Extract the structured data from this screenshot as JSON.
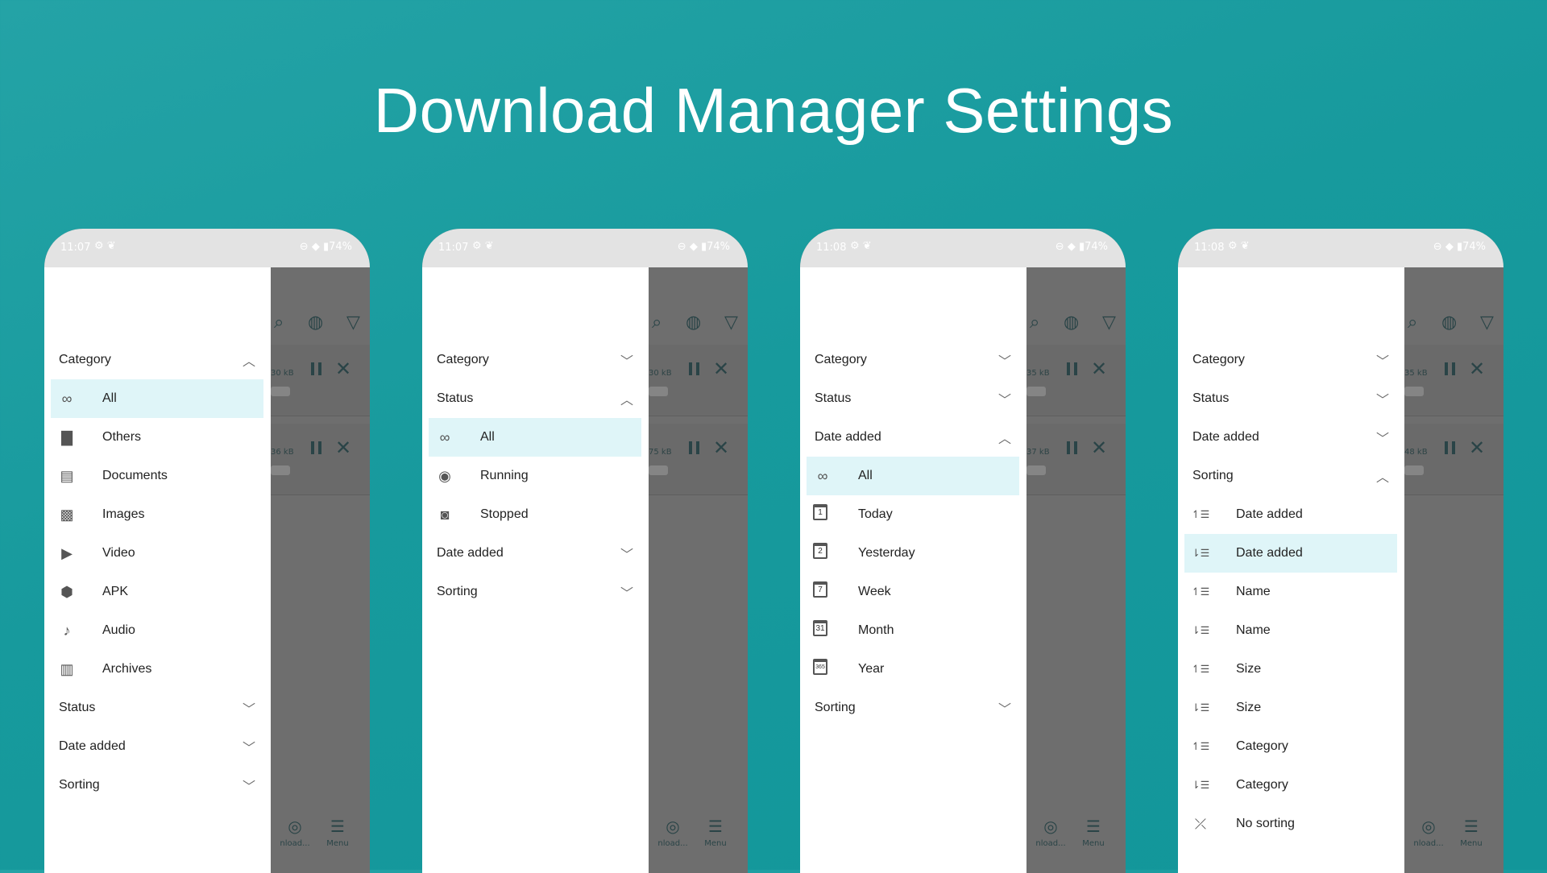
{
  "headline": "Download Manager Settings",
  "phones": [
    {
      "time": "11:07",
      "battery": "74%",
      "menu": [
        {
          "type": "header",
          "label": "Category",
          "chev": "up"
        },
        {
          "type": "item",
          "label": "All",
          "icon": "infinity-icon",
          "glyph": "∞",
          "selected": true
        },
        {
          "type": "item",
          "label": "Others",
          "icon": "file-icon",
          "glyph": "▇"
        },
        {
          "type": "item",
          "label": "Documents",
          "icon": "document-icon",
          "glyph": "▤"
        },
        {
          "type": "item",
          "label": "Images",
          "icon": "image-icon",
          "glyph": "▩"
        },
        {
          "type": "item",
          "label": "Video",
          "icon": "video-icon",
          "glyph": "▶"
        },
        {
          "type": "item",
          "label": "APK",
          "icon": "android-icon",
          "glyph": "⬢"
        },
        {
          "type": "item",
          "label": "Audio",
          "icon": "music-note-icon",
          "glyph": "♪"
        },
        {
          "type": "item",
          "label": "Archives",
          "icon": "archive-icon",
          "glyph": "▥"
        },
        {
          "type": "header",
          "label": "Status",
          "chev": "down"
        },
        {
          "type": "header",
          "label": "Date added",
          "chev": "down"
        },
        {
          "type": "header",
          "label": "Sorting",
          "chev": "down"
        }
      ],
      "cards": [
        "30 kB",
        "36 kB"
      ]
    },
    {
      "time": "11:07",
      "battery": "74%",
      "menu": [
        {
          "type": "header",
          "label": "Category",
          "chev": "down"
        },
        {
          "type": "header",
          "label": "Status",
          "chev": "up"
        },
        {
          "type": "item",
          "label": "All",
          "icon": "infinity-icon",
          "glyph": "∞",
          "selected": true
        },
        {
          "type": "item",
          "label": "Running",
          "icon": "play-circle-icon",
          "glyph": "◉"
        },
        {
          "type": "item",
          "label": "Stopped",
          "icon": "stop-circle-icon",
          "glyph": "◙"
        },
        {
          "type": "header",
          "label": "Date added",
          "chev": "down"
        },
        {
          "type": "header",
          "label": "Sorting",
          "chev": "down"
        }
      ],
      "cards": [
        "30 kB",
        "75 kB"
      ]
    },
    {
      "time": "11:08",
      "battery": "74%",
      "menu": [
        {
          "type": "header",
          "label": "Category",
          "chev": "down"
        },
        {
          "type": "header",
          "label": "Status",
          "chev": "down"
        },
        {
          "type": "header",
          "label": "Date added",
          "chev": "up"
        },
        {
          "type": "item",
          "label": "All",
          "icon": "infinity-icon",
          "glyph": "∞",
          "selected": true
        },
        {
          "type": "item",
          "label": "Today",
          "icon": "calendar-icon",
          "cal": "1"
        },
        {
          "type": "item",
          "label": "Yesterday",
          "icon": "calendar-icon",
          "cal": "2"
        },
        {
          "type": "item",
          "label": "Week",
          "icon": "calendar-icon",
          "cal": "7"
        },
        {
          "type": "item",
          "label": "Month",
          "icon": "calendar-icon",
          "cal": "31"
        },
        {
          "type": "item",
          "label": "Year",
          "icon": "calendar-icon",
          "cal": "365"
        },
        {
          "type": "header",
          "label": "Sorting",
          "chev": "down"
        }
      ],
      "cards": [
        "35 kB",
        "37 kB"
      ]
    },
    {
      "time": "11:08",
      "battery": "74%",
      "menu": [
        {
          "type": "header",
          "label": "Category",
          "chev": "down"
        },
        {
          "type": "header",
          "label": "Status",
          "chev": "down"
        },
        {
          "type": "header",
          "label": "Date added",
          "chev": "down"
        },
        {
          "type": "header",
          "label": "Sorting",
          "chev": "up"
        },
        {
          "type": "item",
          "label": "Date added",
          "icon": "sort-ascending-icon",
          "glyph": "↿☰"
        },
        {
          "type": "item",
          "label": "Date added",
          "icon": "sort-descending-icon",
          "glyph": "⇂☰",
          "selected": true
        },
        {
          "type": "item",
          "label": "Name",
          "icon": "sort-ascending-icon",
          "glyph": "↿☰"
        },
        {
          "type": "item",
          "label": "Name",
          "icon": "sort-descending-icon",
          "glyph": "⇂☰"
        },
        {
          "type": "item",
          "label": "Size",
          "icon": "sort-ascending-icon",
          "glyph": "↿☰"
        },
        {
          "type": "item",
          "label": "Size",
          "icon": "sort-descending-icon",
          "glyph": "⇂☰"
        },
        {
          "type": "item",
          "label": "Category",
          "icon": "sort-ascending-icon",
          "glyph": "↿☰"
        },
        {
          "type": "item",
          "label": "Category",
          "icon": "sort-descending-icon",
          "glyph": "⇂☰"
        },
        {
          "type": "item",
          "label": "No sorting",
          "icon": "no-sorting-icon",
          "glyph": "⤫"
        }
      ],
      "cards": [
        "35 kB",
        "48 kB"
      ]
    }
  ],
  "bottom_nav": {
    "left_label": "nload...",
    "right_label": "Menu"
  }
}
